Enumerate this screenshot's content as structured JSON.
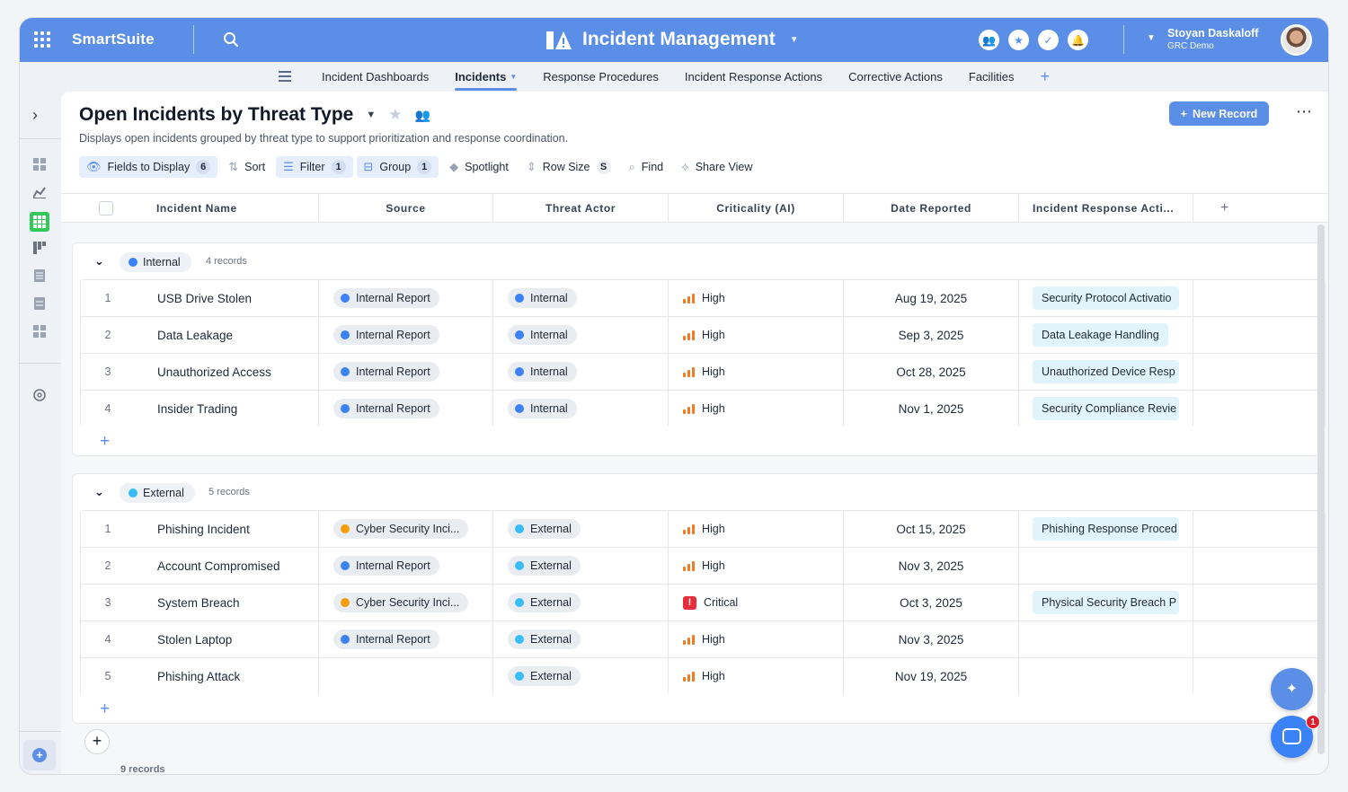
{
  "app": {
    "brand": "SmartSuite",
    "title": "Incident Management",
    "user_name": "Stoyan Daskaloff",
    "user_org": "GRC Demo"
  },
  "nav": {
    "tabs": [
      "Incident Dashboards",
      "Incidents",
      "Response Procedures",
      "Incident Response Actions",
      "Corrective Actions",
      "Facilities"
    ],
    "active": "Incidents"
  },
  "view": {
    "title": "Open Incidents by Threat Type",
    "description": "Displays open incidents grouped by threat type to support prioritization and response coordination.",
    "new_record": "New Record"
  },
  "toolbar": {
    "fields_label": "Fields to Display",
    "fields_count": "6",
    "sort_label": "Sort",
    "filter_label": "Filter",
    "filter_count": "1",
    "group_label": "Group",
    "group_count": "1",
    "spotlight_label": "Spotlight",
    "rowsize_label": "Row Size",
    "rowsize_value": "S",
    "find_label": "Find",
    "share_label": "Share View"
  },
  "columns": {
    "name": "Incident Name",
    "source": "Source",
    "actor": "Threat Actor",
    "criticality": "Criticality (AI)",
    "date": "Date Reported",
    "response": "Incident Response Acti..."
  },
  "colors": {
    "accent": "#5b8ee6",
    "internal_dot": "#3b82f6",
    "external_dot": "#38bdf8",
    "cyber_dot": "#f59e0b",
    "high": "#f07b22",
    "critical": "#e52e3a"
  },
  "groups": [
    {
      "label": "Internal",
      "count_text": "4 records",
      "rows": [
        {
          "n": "1",
          "name": "USB Drive Stolen",
          "source": "Internal Report",
          "actor": "Internal",
          "crit": "High",
          "date": "Aug 19, 2025",
          "response": "Security Protocol Activatio"
        },
        {
          "n": "2",
          "name": "Data Leakage",
          "source": "Internal Report",
          "actor": "Internal",
          "crit": "High",
          "date": "Sep 3, 2025",
          "response": "Data Leakage Handling"
        },
        {
          "n": "3",
          "name": "Unauthorized Access",
          "source": "Internal Report",
          "actor": "Internal",
          "crit": "High",
          "date": "Oct 28, 2025",
          "response": "Unauthorized Device Resp"
        },
        {
          "n": "4",
          "name": "Insider Trading",
          "source": "Internal Report",
          "actor": "Internal",
          "crit": "High",
          "date": "Nov 1, 2025",
          "response": "Security Compliance Revie"
        }
      ]
    },
    {
      "label": "External",
      "count_text": "5 records",
      "rows": [
        {
          "n": "1",
          "name": "Phishing Incident",
          "source": "Cyber Security Inci...",
          "actor": "External",
          "crit": "High",
          "date": "Oct 15, 2025",
          "response": "Phishing Response Proced"
        },
        {
          "n": "2",
          "name": "Account Compromised",
          "source": "Internal Report",
          "actor": "External",
          "crit": "High",
          "date": "Nov 3, 2025",
          "response": ""
        },
        {
          "n": "3",
          "name": "System Breach",
          "source": "Cyber Security Inci...",
          "actor": "External",
          "crit": "Critical",
          "date": "Oct 3, 2025",
          "response": "Physical Security Breach P"
        },
        {
          "n": "4",
          "name": "Stolen Laptop",
          "source": "Internal Report",
          "actor": "External",
          "crit": "High",
          "date": "Nov 3, 2025",
          "response": ""
        },
        {
          "n": "5",
          "name": "Phishing Attack",
          "source": "",
          "actor": "External",
          "crit": "High",
          "date": "Nov 19, 2025",
          "response": ""
        }
      ]
    }
  ],
  "footer": {
    "total": "9 records"
  },
  "notifications": {
    "badge": "1"
  }
}
